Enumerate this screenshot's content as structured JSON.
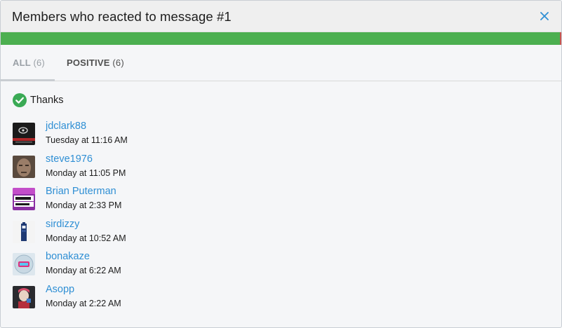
{
  "dialog": {
    "title": "Members who reacted to message #1",
    "close_icon": "close-icon"
  },
  "reaction_bar": {
    "positive_fraction": 0.995,
    "positive_color": "#4caf50",
    "negative_color": "#c9534f"
  },
  "tabs": [
    {
      "label": "ALL",
      "count": "(6)",
      "active": true
    },
    {
      "label": "POSITIVE",
      "count": "(6)",
      "active": false
    }
  ],
  "section": {
    "icon": "checkmark-circle-icon",
    "label": "Thanks"
  },
  "members": [
    {
      "name": "jdclark88",
      "time": "Tuesday at 11:16 AM",
      "avatar": "avatar-dark-banner"
    },
    {
      "name": "steve1976",
      "time": "Monday at 11:05 PM",
      "avatar": "avatar-photo-face"
    },
    {
      "name": "Brian Puterman",
      "time": "Monday at 2:33 PM",
      "avatar": "avatar-ninja-week"
    },
    {
      "name": "sirdizzy",
      "time": "Monday at 10:52 AM",
      "avatar": "avatar-police-box"
    },
    {
      "name": "bonakaze",
      "time": "Monday at 6:22 AM",
      "avatar": "avatar-pink-logo"
    },
    {
      "name": "Asopp",
      "time": "Monday at 2:22 AM",
      "avatar": "avatar-character"
    }
  ]
}
